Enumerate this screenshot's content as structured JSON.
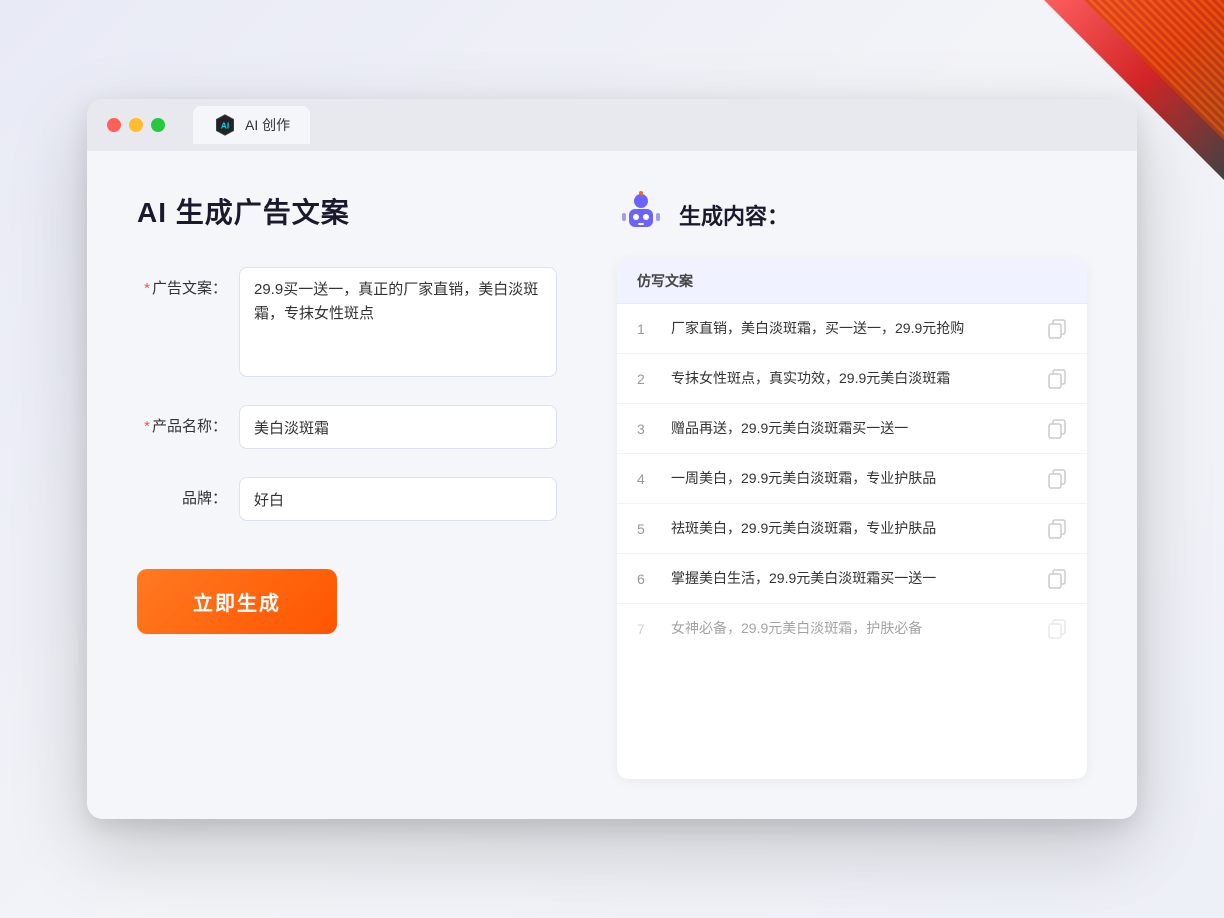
{
  "decoration": {
    "corner": "top-right decorative element"
  },
  "browser": {
    "tab_title": "AI 创作",
    "traffic_lights": [
      "red",
      "yellow",
      "green"
    ]
  },
  "left": {
    "page_title": "AI 生成广告文案",
    "form": {
      "ad_copy_label": "广告文案：",
      "ad_copy_required": "*",
      "ad_copy_value": "29.9买一送一，真正的厂家直销，美白淡斑霜，专抹女性斑点",
      "product_name_label": "产品名称：",
      "product_name_required": "*",
      "product_name_value": "美白淡斑霜",
      "brand_label": "品牌：",
      "brand_value": "好白"
    },
    "generate_button": "立即生成"
  },
  "right": {
    "result_title": "生成内容：",
    "table_header": "仿写文案",
    "results": [
      {
        "num": "1",
        "text": "厂家直销，美白淡斑霜，买一送一，29.9元抢购",
        "dimmed": false
      },
      {
        "num": "2",
        "text": "专抹女性斑点，真实功效，29.9元美白淡斑霜",
        "dimmed": false
      },
      {
        "num": "3",
        "text": "赠品再送，29.9元美白淡斑霜买一送一",
        "dimmed": false
      },
      {
        "num": "4",
        "text": "一周美白，29.9元美白淡斑霜，专业护肤品",
        "dimmed": false
      },
      {
        "num": "5",
        "text": "祛斑美白，29.9元美白淡斑霜，专业护肤品",
        "dimmed": false
      },
      {
        "num": "6",
        "text": "掌握美白生活，29.9元美白淡斑霜买一送一",
        "dimmed": false
      },
      {
        "num": "7",
        "text": "女神必备，29.9元美白淡斑霜，护肤必备",
        "dimmed": true
      }
    ]
  }
}
